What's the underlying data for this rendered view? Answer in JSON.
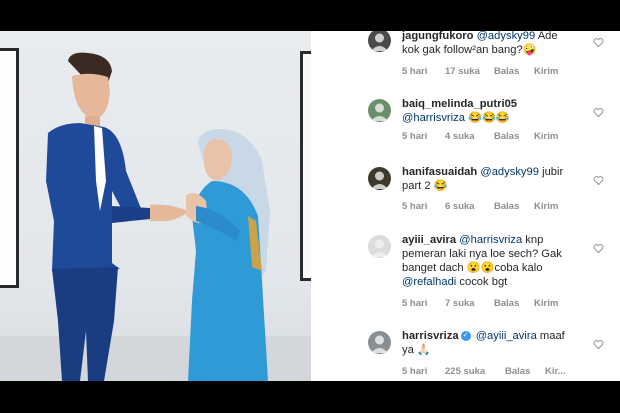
{
  "comments": [
    {
      "username": "jagungfukoro",
      "mention": "@adysky99",
      "text": " Ade kok gak follow²an bang?🤪",
      "time": "5 hari",
      "likes": "17 suka",
      "reply": "Balas",
      "send": "Kirim",
      "verified": false,
      "avatar_color": "#4a4a4a"
    },
    {
      "username": "baiq_melinda_putri05",
      "mention": "@harrisvriza",
      "text": " 😂😂😂",
      "time": "5 hari",
      "likes": "4 suka",
      "reply": "Balas",
      "send": "Kirim",
      "verified": false,
      "avatar_color": "#6a8f6a"
    },
    {
      "username": "hanifasuaidah",
      "mention": "@adysky99",
      "text": " jubir part 2 😂",
      "time": "5 hari",
      "likes": "6 suka",
      "reply": "Balas",
      "send": "Kirim",
      "verified": false,
      "avatar_color": "#3d3a2a"
    },
    {
      "username": "ayiii_avira",
      "mention": "@harrisvriza",
      "text": " knp pemeran laki nya loe sech? Gak banget dach 😮😮coba kalo ",
      "mention2": "@refalhadi",
      "text2": " cocok bgt",
      "time": "5 hari",
      "likes": "7 suka",
      "reply": "Balas",
      "send": "Kirim",
      "verified": false,
      "avatar_color": "#dcdcdc"
    },
    {
      "username": "harrisvriza",
      "mention": "@ayiii_avira",
      "text": " maaf ya 🙏🏻",
      "time": "5 hari",
      "likes": "225 suka",
      "reply": "Balas",
      "send": "Kir...",
      "verified": true,
      "avatar_color": "#8a8f93"
    }
  ],
  "icons": {
    "heart": "heart-outline-icon",
    "verified": "verified-badge-icon"
  },
  "colors": {
    "mention": "#00376b",
    "meta": "#8e8e8e",
    "verified": "#3897f0",
    "dress": "#2e9ad6",
    "suit": "#1f4a9a"
  }
}
